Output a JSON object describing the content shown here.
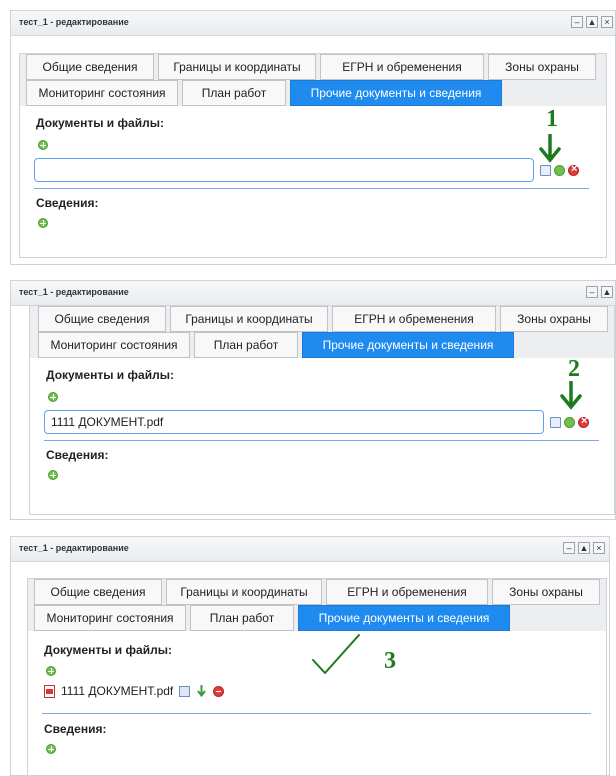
{
  "window": {
    "title": "тест_1 - редактирование",
    "btn_min": "–",
    "btn_max": "▲",
    "btn_close": "×"
  },
  "tabs": {
    "row1": [
      "Общие сведения",
      "Границы и координаты",
      "ЕГРН и обременения",
      "Зоны охраны"
    ],
    "row2": [
      "Мониторинг состояния",
      "План работ",
      "Прочие документы и сведения"
    ]
  },
  "sections": {
    "documents": "Документы и файлы:",
    "info": "Сведения:"
  },
  "inputs": {
    "step1_value": "",
    "step2_value": "1111 ДОКУМЕНТ.pdf"
  },
  "file": {
    "name": "1111 ДОКУМЕНТ.pdf"
  },
  "annotations": {
    "step1": "1",
    "step2": "2",
    "step3": "3"
  },
  "colors": {
    "active_tab": "#1f8bef",
    "annotation": "#1d7a1d"
  }
}
